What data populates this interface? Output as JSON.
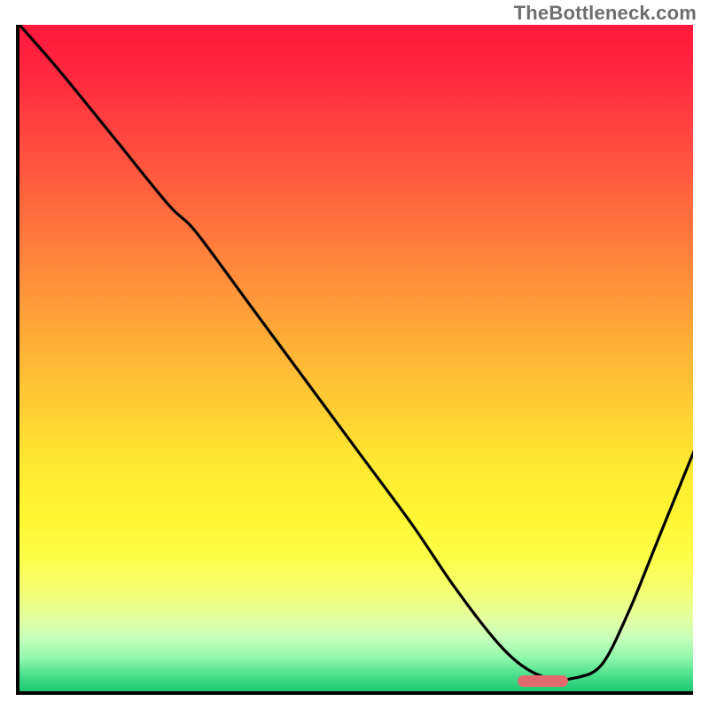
{
  "watermark": "TheBottleneck.com",
  "colors": {
    "pill": "#e26a6f",
    "curve": "#000000",
    "axis": "#000000"
  },
  "pill": {
    "x_frac": 0.735,
    "y_frac": 0.976,
    "w_frac": 0.075,
    "h_frac": 0.018
  },
  "chart_data": {
    "type": "line",
    "title": "",
    "xlabel": "",
    "ylabel": "",
    "xlim": [
      0,
      100
    ],
    "ylim": [
      0,
      100
    ],
    "grid": false,
    "legend": false,
    "series": [
      {
        "name": "bottleneck-curve",
        "x": [
          0,
          6,
          14,
          22,
          26,
          34,
          42,
          50,
          58,
          64,
          70,
          74,
          78,
          82,
          86,
          90,
          94,
          98,
          100
        ],
        "y": [
          100,
          93,
          83,
          73,
          69,
          58,
          47,
          36,
          25,
          16,
          8,
          4,
          2,
          2,
          4,
          12,
          22,
          32,
          37
        ]
      }
    ],
    "annotations": [
      {
        "type": "text",
        "text": "TheBottleneck.com",
        "position": "top-right"
      },
      {
        "type": "marker",
        "shape": "pill",
        "color": "#e26a6f",
        "x_range": [
          73,
          81
        ],
        "y": 2
      }
    ],
    "background": "red-yellow-green vertical gradient (red top, green bottom)"
  }
}
